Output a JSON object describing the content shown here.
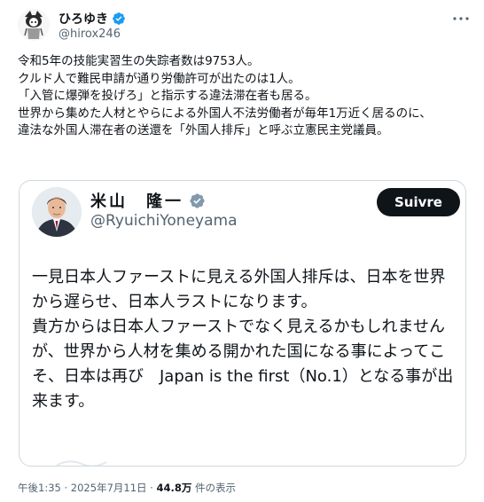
{
  "author": {
    "display_name": "ひろゆき",
    "handle": "@hirox246",
    "avatar_icon": "cartoon-avatar-icon",
    "verified_icon": "verified-badge-icon",
    "badge_color": "#1d9bf0"
  },
  "more_icon": "more-dots-icon",
  "tweet": {
    "text": "令和5年の技能実習生の失踪者数は9753人。\nクルド人で難民申請が通り労働許可が出たのは1人。\n「入管に爆弾を投げろ」と指示する違法滞在者も居る。\n世界から集めた人材とやらによる外国人不法労働者が毎年1万近く居るのに、\n違法な外国人滞在者の送還を「外国人排斥」と呼ぶ立憲民主党議員。"
  },
  "quoted": {
    "display_name": "米山　隆一",
    "handle": "@RyuichiYoneyama",
    "avatar_icon": "profile-photo",
    "verified_icon": "government-verified-badge-icon",
    "badge_color": "#829aab",
    "follow_label": "Suivre",
    "text": "一見日本人ファーストに見える外国人排斥は、日本を世界から遅らせ、日本人ラストになります。\n貴方からは日本人ファーストでなく見えるかもしれませんが、世界から人材を集める開かれた国になる事によってこそ、日本は再び　Japan is the first（No.1）となる事が出来ます。"
  },
  "meta": {
    "time": "午後1:35",
    "separator": "·",
    "date": "2025年7月11日",
    "separator2": "·",
    "views_count": "44.8万",
    "views_label": "件の表示"
  }
}
